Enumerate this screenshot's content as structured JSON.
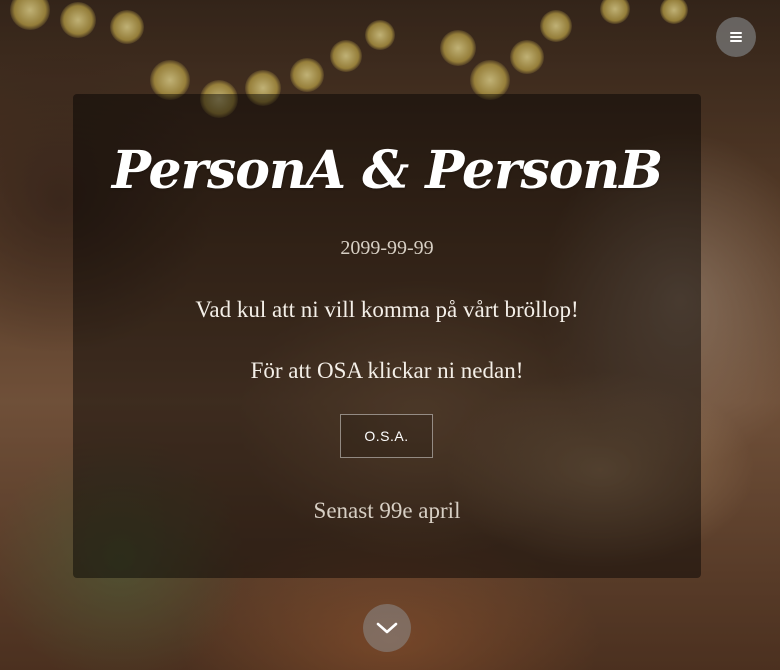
{
  "header": {
    "menu_icon": "hamburger-icon"
  },
  "hero": {
    "names": "PersonA & PersonB",
    "date": "2099-99-99",
    "welcome": "Vad kul att ni vill komma på vårt bröllop!",
    "rsvp_prompt": "För att OSA klickar ni nedan!",
    "rsvp_button_label": "O.S.A.",
    "deadline": "Senast 99e april"
  },
  "footer": {
    "scroll_icon": "chevron-down-icon"
  },
  "colors": {
    "card_overlay": "#000000",
    "text": "#ffffff",
    "muted_text": "#d7cfc4"
  }
}
